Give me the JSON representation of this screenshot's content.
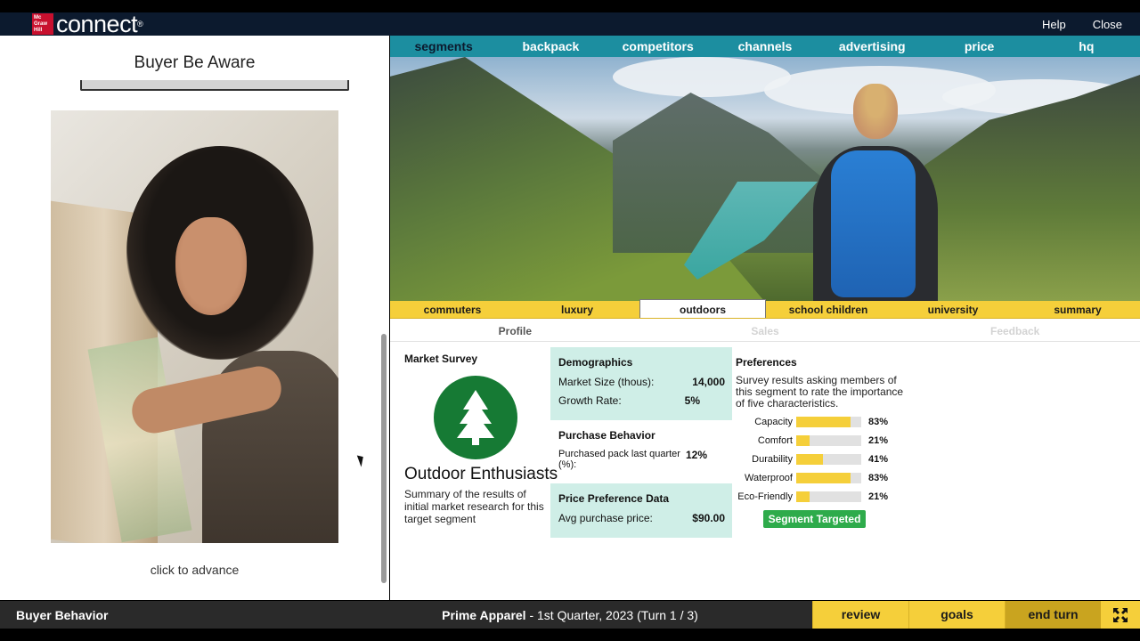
{
  "header": {
    "logo_mark": "Mc Graw Hill",
    "logo_text": "connect",
    "logo_reg": "®",
    "help": "Help",
    "close": "Close"
  },
  "left": {
    "title": "Buyer Be Aware",
    "advance": "click to advance"
  },
  "main_tabs": [
    "segments",
    "backpack",
    "competitors",
    "channels",
    "advertising",
    "price",
    "hq"
  ],
  "segment_tabs": [
    "commuters",
    "luxury",
    "outdoors",
    "school children",
    "university",
    "summary"
  ],
  "sub_tabs": [
    "Profile",
    "Sales",
    "Feedback"
  ],
  "survey": {
    "label": "Market Survey",
    "segment_name": "Outdoor Enthusiasts",
    "summary": "Summary of the results of initial market research for this target segment"
  },
  "demographics": {
    "title": "Demographics",
    "market_size_label": "Market Size (thous):",
    "market_size": "14,000",
    "growth_label": "Growth Rate:",
    "growth": "5%"
  },
  "purchase": {
    "title": "Purchase Behavior",
    "label": "Purchased pack last quarter (%):",
    "value": "12%"
  },
  "price_pref": {
    "title": "Price Preference Data",
    "label": "Avg purchase price:",
    "value": "$90.00"
  },
  "preferences": {
    "title": "Preferences",
    "description": "Survey results asking members of this segment to rate the importance of five characteristics.",
    "items": [
      {
        "label": "Capacity",
        "pct": "83%",
        "value": 83
      },
      {
        "label": "Comfort",
        "pct": "21%",
        "value": 21
      },
      {
        "label": "Durability",
        "pct": "41%",
        "value": 41
      },
      {
        "label": "Waterproof",
        "pct": "83%",
        "value": 83
      },
      {
        "label": "Eco-Friendly",
        "pct": "21%",
        "value": 21
      }
    ],
    "targeted_label": "Segment Targeted"
  },
  "footer": {
    "module": "Buyer Behavior",
    "company": "Prime Apparel",
    "period": " - 1st Quarter, 2023 (Turn 1 / 3)",
    "review": "review",
    "goals": "goals",
    "end_turn": "end turn"
  },
  "colors": {
    "accent_teal": "#1c8ea0",
    "accent_yellow": "#f5cf3a",
    "targeted_green": "#2eab4b",
    "tree_green": "#167a34"
  }
}
